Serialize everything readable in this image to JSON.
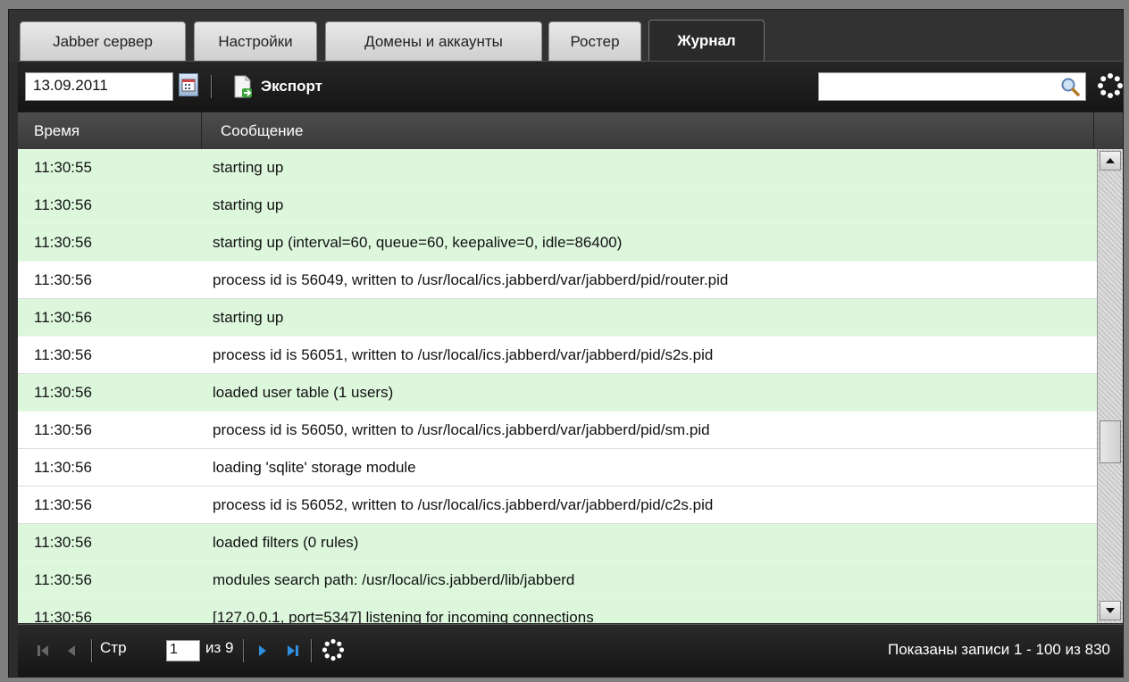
{
  "tabs": [
    {
      "label": "Jabber сервер"
    },
    {
      "label": "Настройки"
    },
    {
      "label": "Домены и аккаунты"
    },
    {
      "label": "Ростер"
    },
    {
      "label": "Журнал"
    }
  ],
  "active_tab": "Журнал",
  "toolbar": {
    "date_value": "13.09.2011",
    "export_label": "Экспорт",
    "search_value": ""
  },
  "columns": {
    "time": "Время",
    "message": "Сообщение"
  },
  "rows": [
    {
      "time": "11:30:55",
      "message": "starting up",
      "highlight": true
    },
    {
      "time": "11:30:56",
      "message": "starting up",
      "highlight": true
    },
    {
      "time": "11:30:56",
      "message": "starting up (interval=60, queue=60, keepalive=0, idle=86400)",
      "highlight": true
    },
    {
      "time": "11:30:56",
      "message": "process id is 56049, written to /usr/local/ics.jabberd/var/jabberd/pid/router.pid",
      "highlight": false
    },
    {
      "time": "11:30:56",
      "message": "starting up",
      "highlight": true
    },
    {
      "time": "11:30:56",
      "message": "process id is 56051, written to /usr/local/ics.jabberd/var/jabberd/pid/s2s.pid",
      "highlight": false
    },
    {
      "time": "11:30:56",
      "message": "loaded user table (1 users)",
      "highlight": true
    },
    {
      "time": "11:30:56",
      "message": "process id is 56050, written to /usr/local/ics.jabberd/var/jabberd/pid/sm.pid",
      "highlight": false
    },
    {
      "time": "11:30:56",
      "message": "loading 'sqlite' storage module",
      "highlight": false
    },
    {
      "time": "11:30:56",
      "message": "process id is 56052, written to /usr/local/ics.jabberd/var/jabberd/pid/c2s.pid",
      "highlight": false
    },
    {
      "time": "11:30:56",
      "message": "loaded filters (0 rules)",
      "highlight": true
    },
    {
      "time": "11:30:56",
      "message": "modules search path: /usr/local/ics.jabberd/lib/jabberd",
      "highlight": true
    },
    {
      "time": "11:30:56",
      "message": "[127.0.0.1, port=5347] listening for incoming connections",
      "highlight": true
    }
  ],
  "pager": {
    "page_label": "Стр",
    "page_value": "1",
    "of_label": "из 9",
    "info": "Показаны записи 1 - 100 из 830"
  },
  "colors": {
    "row_highlight": "#ddf7dd",
    "nav_blue": "#2f8fe0"
  }
}
